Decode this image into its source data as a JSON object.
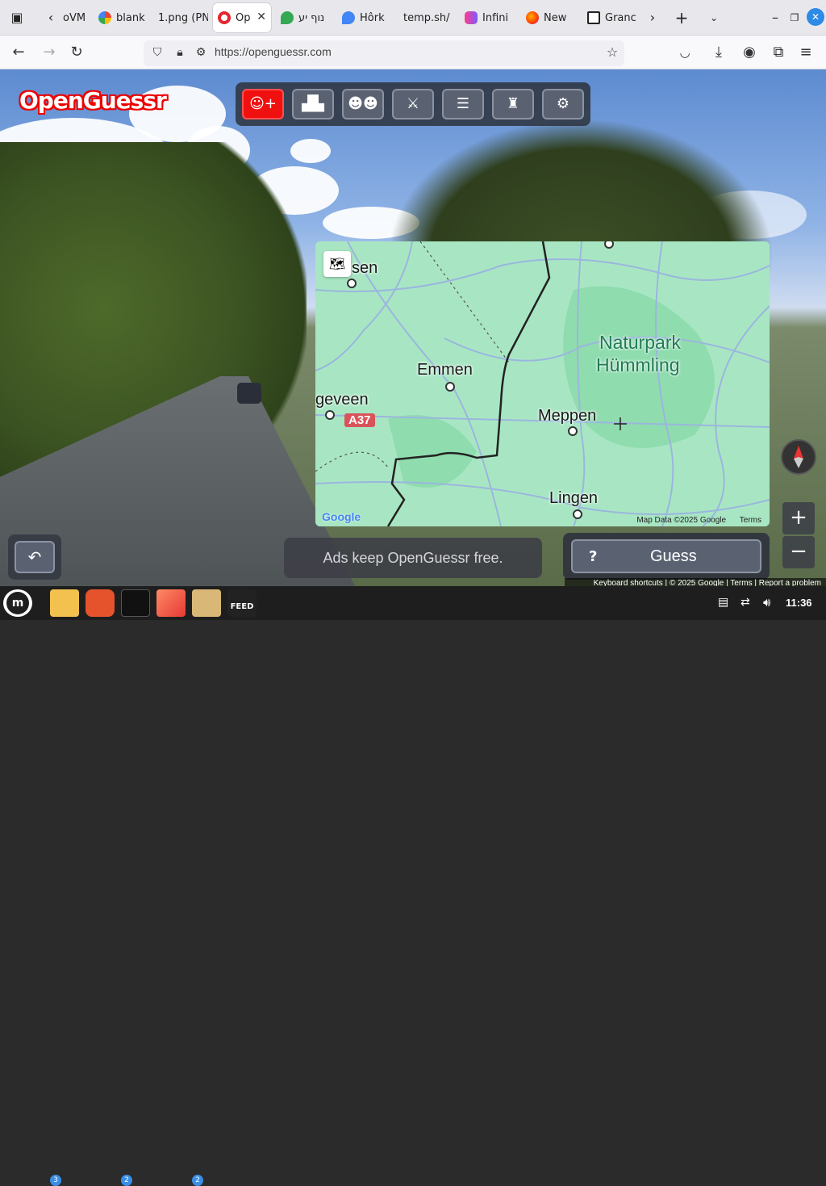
{
  "browser": {
    "tabs": [
      {
        "label": "oVM",
        "icon": "page-icon"
      },
      {
        "label": "blank",
        "icon": "google-icon"
      },
      {
        "label": "1.png (PN",
        "icon": "image-icon"
      },
      {
        "label": "Op",
        "icon": "openguessr-icon",
        "active": true
      },
      {
        "label": "נוף יע",
        "icon": "maps-pin-icon"
      },
      {
        "label": "Hôrk",
        "icon": "maps-pin-icon"
      },
      {
        "label": "temp.sh/",
        "icon": "page-icon"
      },
      {
        "label": "Infini",
        "icon": "infinity-icon"
      },
      {
        "label": "New",
        "icon": "firefox-icon"
      },
      {
        "label": "Granc",
        "icon": "museum-icon"
      }
    ],
    "url": "https://openguessr.com"
  },
  "app": {
    "logo_text": "OpenGuessr",
    "toolbar_buttons": [
      {
        "name": "add-player",
        "icon": "person-plus-icon",
        "accent": "#f01010"
      },
      {
        "name": "leaderboard",
        "icon": "podium-icon"
      },
      {
        "name": "friends",
        "icon": "group-icon"
      },
      {
        "name": "battle",
        "icon": "swords-icon"
      },
      {
        "name": "map-layers",
        "icon": "layers-icon"
      },
      {
        "name": "profile",
        "icon": "stamp-icon"
      },
      {
        "name": "settings",
        "icon": "gear-icon"
      }
    ],
    "map": {
      "labels": {
        "sen": "sen",
        "emmen": "Emmen",
        "geveen": "geveen",
        "a37": "A37",
        "meppen": "Meppen",
        "lingen": "Lingen",
        "naturpark_1": "Naturpark",
        "naturpark_2": "Hümmling"
      },
      "google": "Google",
      "map_data": "Map Data ©2025 Google",
      "terms": "Terms"
    },
    "ads_text": "Ads keep OpenGuessr free.",
    "guess": {
      "help": "?",
      "label": "Guess"
    },
    "zoom": {
      "in": "+",
      "out": "−"
    },
    "footer": {
      "shortcuts": "Keyboard shortcuts",
      "copyright": "© 2025 Google",
      "terms": "Terms",
      "report": "Report a problem"
    }
  },
  "taskbar": {
    "badges": {
      "files": "3",
      "terminal": "2",
      "archive": "2"
    },
    "feed_label": "FEED",
    "clock": "11:36"
  }
}
